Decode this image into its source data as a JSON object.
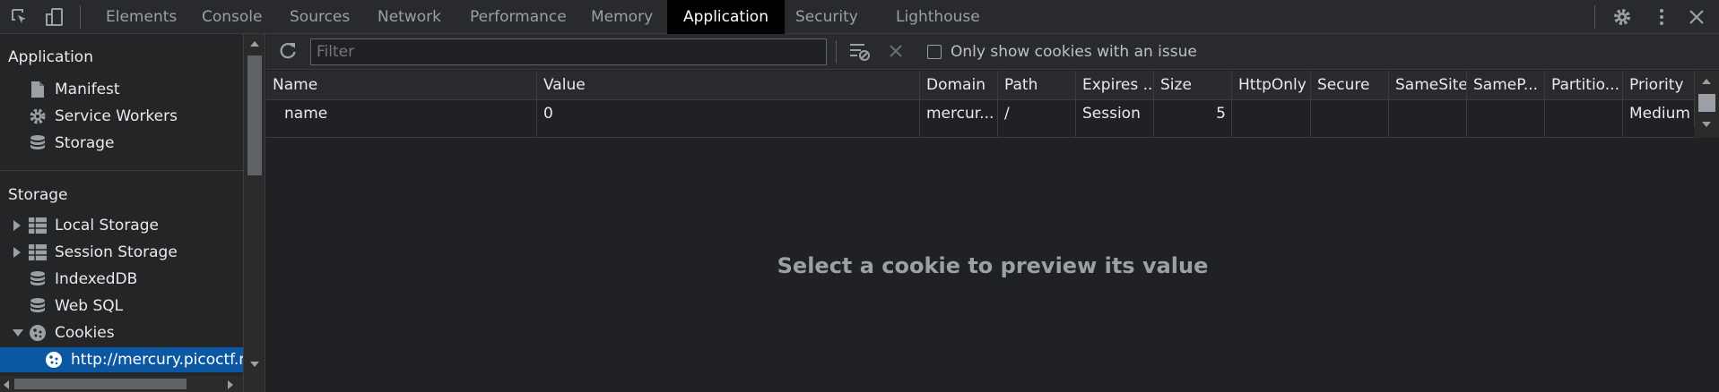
{
  "devtools": {
    "tabs": [
      "Elements",
      "Console",
      "Sources",
      "Network",
      "Performance",
      "Memory",
      "Application",
      "Security",
      "Lighthouse"
    ],
    "active_tab": "Application"
  },
  "sidebar": {
    "application_heading": "Application",
    "application_items": [
      "Manifest",
      "Service Workers",
      "Storage"
    ],
    "storage_heading": "Storage",
    "storage_items": [
      "Local Storage",
      "Session Storage",
      "IndexedDB",
      "Web SQL",
      "Cookies"
    ],
    "cookie_origin": "http://mercury.picoctf.net"
  },
  "toolbar": {
    "filter_placeholder": "Filter",
    "only_issues_label": "Only show cookies with an issue"
  },
  "cookie_table": {
    "columns": [
      "Name",
      "Value",
      "Domain",
      "Path",
      "Expires ...",
      "Size",
      "HttpOnly",
      "Secure",
      "SameSite",
      "SameP...",
      "Partitio...",
      "Priority"
    ],
    "rows": [
      [
        "name",
        "0",
        "mercur...",
        "/",
        "Session",
        "5",
        "",
        "",
        "",
        "",
        "",
        "Medium"
      ]
    ]
  },
  "preview_message": "Select a cookie to preview its value",
  "colors": {
    "active_tab_bg": "#000000",
    "selected_row": "#0b57a1",
    "background": "#202124"
  }
}
